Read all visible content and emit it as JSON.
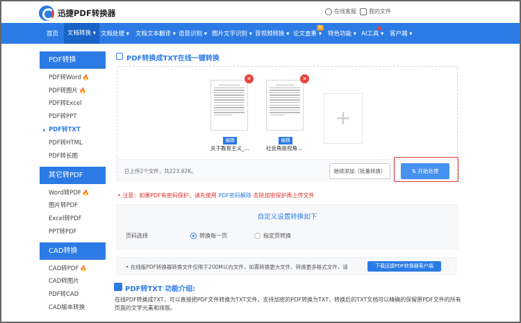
{
  "header": {
    "brand": "迅捷PDF转换器",
    "service_label": "在线客服",
    "files_label": "我的文件"
  },
  "nav": {
    "items": [
      "首页",
      "文档转换",
      "文档处理",
      "文档文本翻译",
      "语音识别",
      "图片文字识别",
      "音视频转换",
      "论文查重",
      "特色功能",
      "AI工具",
      "客户端"
    ],
    "active": "文档转换",
    "badge_new": "新"
  },
  "sidebar": {
    "sections": [
      {
        "title": "PDF转换",
        "items": [
          "PDF转Word",
          "PDF转图片",
          "PDF转Excel",
          "PDF转PPT",
          "PDF转TXT",
          "PDF转HTML",
          "PDF转长图"
        ]
      },
      {
        "title": "其它转PDF",
        "items": [
          "Word转PDF",
          "图片转PDF",
          "Excel转PDF",
          "PPT转PDF"
        ]
      },
      {
        "title": "CAD转换",
        "items": [
          "CAD转PDF",
          "CAD转图片",
          "PDF转CAD",
          "CAD版本转换"
        ]
      }
    ],
    "current": "PDF转TXT"
  },
  "main": {
    "title": "PDF转换成TXT在线一键转换",
    "files": [
      {
        "name": "关于教育主义_...",
        "edit": "编辑"
      },
      {
        "name": "社会角度视角...",
        "edit": "编辑"
      }
    ],
    "upload_info": "已上传2个文件，共223.92K。",
    "continue_button": "继续添加（批量转换）",
    "start_button": "开始处理",
    "note_prefix": "注意：如果PDF有密码保护，请先使用",
    "note_link": "PDF密码解除",
    "note_suffix": "去除加密保护再上传文件"
  },
  "settings": {
    "title": "自定义设置转换如下",
    "page_label": "页码选择",
    "option_each": "转换每一页",
    "option_range": "指定页转换",
    "selected": "转换每一页"
  },
  "tip": {
    "text": "在线版PDF转换器转换文件仅限于200M以内文件，如需转换更大文件、转换更多格式文件，请",
    "button": "下载迅捷PDF转换器客户端"
  },
  "intro": {
    "title": "PDF转TXT 功能介绍:",
    "body": "在线PDF转换成TXT，可以直接把PDF文件转换为TXT文件，支持加密的PDF转换为TXT，转换后的TXT文档可以精确的保留原PDF文件的所有页面的文字元素和排版。"
  }
}
